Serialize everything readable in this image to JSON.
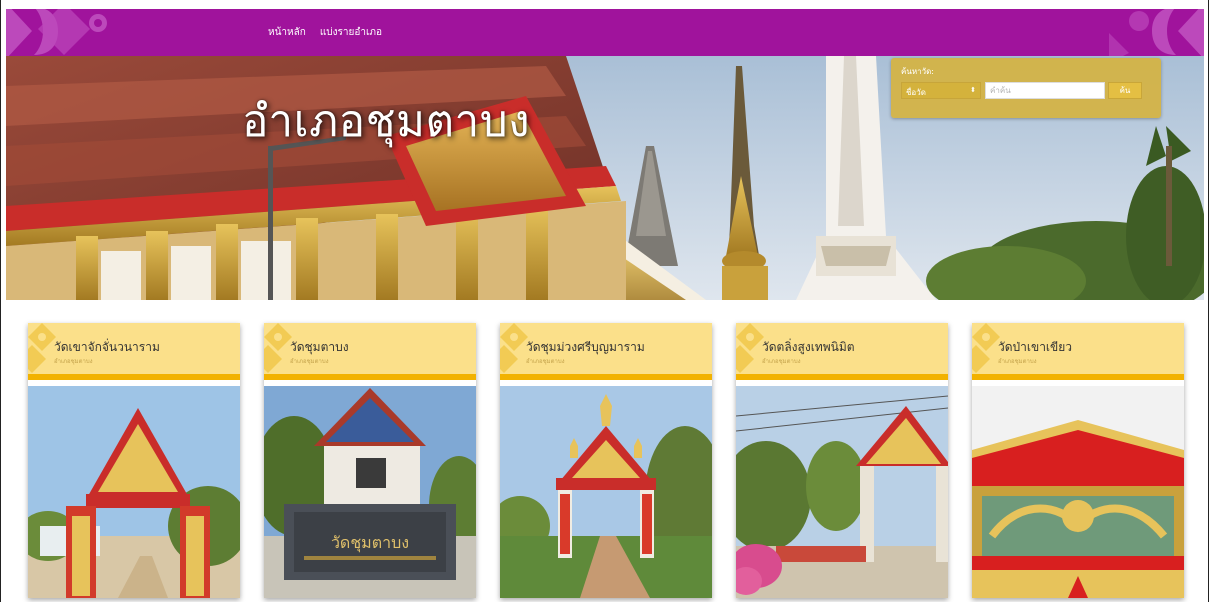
{
  "nav": {
    "links": [
      "หน้าหลัก",
      "แบ่งรายอำเภอ"
    ]
  },
  "hero": {
    "title": "อำเภอชุมตาบง"
  },
  "search": {
    "label": "ค้นหาวัด:",
    "select_value": "ชื่อวัด",
    "input_placeholder": "คำค้น",
    "button_label": "ค้น"
  },
  "cards": [
    {
      "title": "วัดเขาจักจั่นวนาราม",
      "subtitle": "อำเภอชุมตาบง"
    },
    {
      "title": "วัดชุมตาบง",
      "subtitle": "อำเภอชุมตาบง"
    },
    {
      "title": "วัดชุมม่วงศรีบุญมาราม",
      "subtitle": "อำเภอชุมตาบง"
    },
    {
      "title": "วัดตลิ่งสูงเทพนิมิต",
      "subtitle": "อำเภอชุมตาบง"
    },
    {
      "title": "วัดป่าเขาเขียว",
      "subtitle": "อำเภอชุมตาบง"
    }
  ],
  "card_images": {
    "sign_text": "วัดชุมตาบง"
  },
  "colors": {
    "nav": "#a0139c",
    "card_head": "#fbe08a",
    "card_band": "#f2b200",
    "search_panel": "#d6b23a"
  }
}
